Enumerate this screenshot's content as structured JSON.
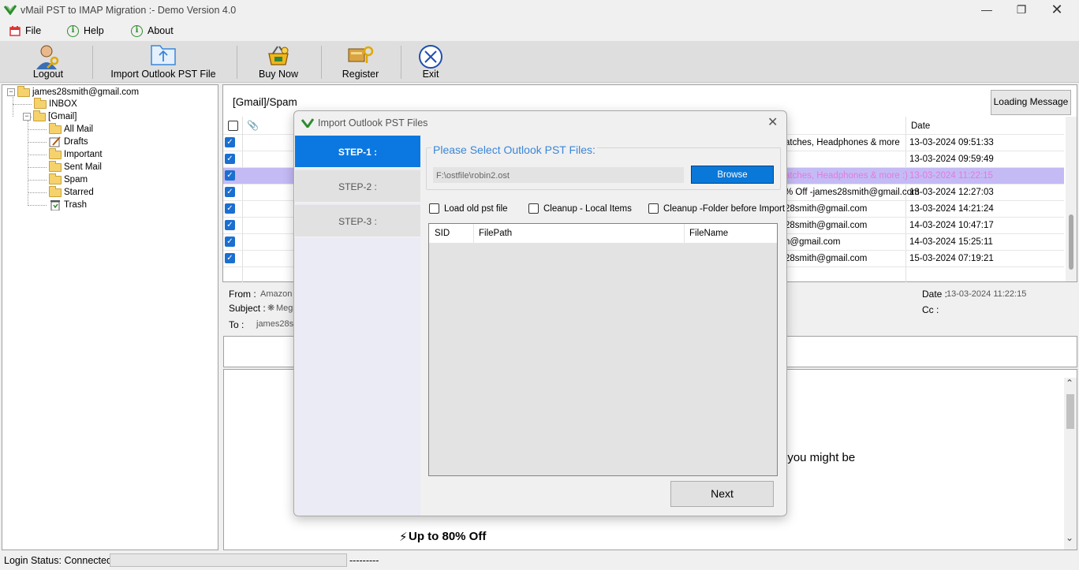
{
  "window": {
    "title": "vMail PST to IMAP Migration :- Demo Version 4.0"
  },
  "menu": {
    "items": [
      {
        "label": "File"
      },
      {
        "label": "Help"
      },
      {
        "label": "About"
      }
    ]
  },
  "toolbar": {
    "logout": "Logout",
    "import": "Import Outlook PST File",
    "buy": "Buy Now",
    "register": "Register",
    "exit": "Exit"
  },
  "tree": {
    "account": "james28smith@gmail.com",
    "inbox": "INBOX",
    "gmail": "[Gmail]",
    "children": [
      "All Mail",
      "Drafts",
      "Important",
      "Sent Mail",
      "Spam",
      "Starred",
      "Trash"
    ]
  },
  "mailview": {
    "folder_path": "[Gmail]/Spam",
    "loading_button": "Loading Message",
    "date_header": "Date",
    "rows": [
      {
        "from": "atches, Headphones & more",
        "date": "13-03-2024 09:51:33"
      },
      {
        "from": "",
        "date": "13-03-2024 09:59:49"
      },
      {
        "from": "atches, Headphones & more :)",
        "date": "13-03-2024 11:22:15"
      },
      {
        "from": "% Off -james28smith@gmail.com",
        "date": "13-03-2024 12:27:03"
      },
      {
        "from": "28smith@gmail.com",
        "date": "13-03-2024 14:21:24"
      },
      {
        "from": "28smith@gmail.com",
        "date": "14-03-2024 10:47:17"
      },
      {
        "from": "h@gmail.com",
        "date": "14-03-2024 15:25:11"
      },
      {
        "from": "28smith@gmail.com",
        "date": "15-03-2024 07:19:21"
      }
    ]
  },
  "message": {
    "from_label": "From :",
    "from_value": "Amazon I",
    "subject_label": "Subject :",
    "subject_value": "Mega",
    "to_label": "To :",
    "to_value": "james28sn",
    "date_label": "Date :",
    "date_value": "13-03-2024 11:22:15",
    "cc_label": "Cc :",
    "body_text_1": "t you might be",
    "body_text_2": "Up to 80% Off"
  },
  "status": {
    "label": "Login Status: Connected",
    "dashes": "---------"
  },
  "dialog": {
    "title": "Import Outlook PST Files",
    "steps": [
      "STEP-1 :",
      "STEP-2 :",
      "STEP-3 :"
    ],
    "group_title": "Please Select Outlook PST Files:",
    "path_value": "F:\\ostfile\\robin2.ost",
    "browse": "Browse",
    "options": [
      "Load old pst file",
      "Cleanup - Local Items",
      "Cleanup -Folder before Import"
    ],
    "columns": [
      "SID",
      "FilePath",
      "FileName"
    ],
    "next": "Next"
  }
}
